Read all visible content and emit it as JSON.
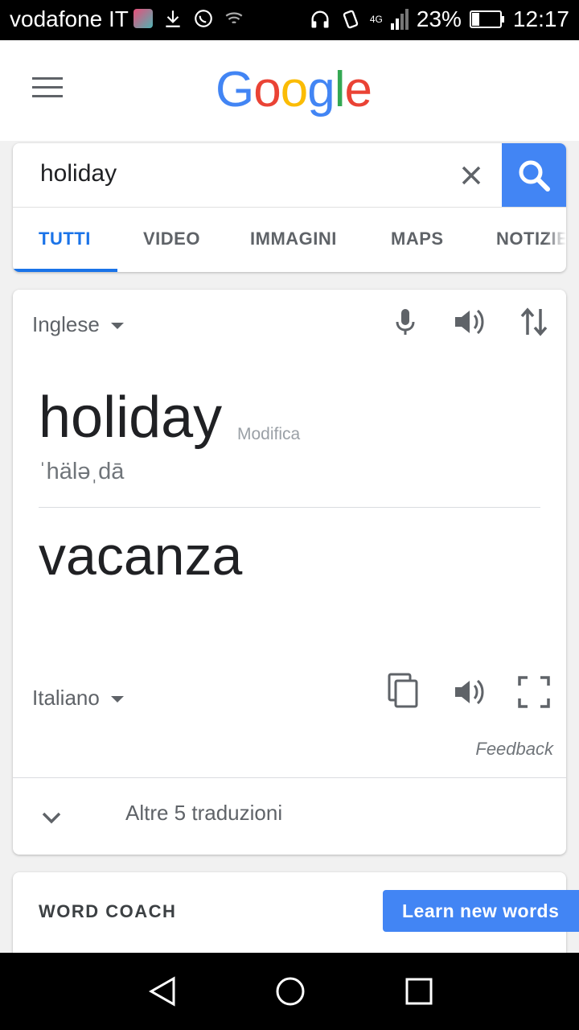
{
  "status_bar": {
    "carrier": "vodafone IT",
    "network": "4G",
    "battery": "23%",
    "time": "12:17"
  },
  "header": {
    "logo": {
      "letters": [
        "G",
        "o",
        "o",
        "g",
        "l",
        "e"
      ],
      "colors": [
        "#4285f4",
        "#ea4335",
        "#fbbc05",
        "#4285f4",
        "#34a853",
        "#ea4335"
      ]
    }
  },
  "search": {
    "query": "holiday",
    "tabs": [
      "TUTTI",
      "VIDEO",
      "IMMAGINI",
      "MAPS",
      "NOTIZIE"
    ],
    "active_tab": "TUTTI",
    "accent": "#4285f4"
  },
  "translate": {
    "source_lang": "Inglese",
    "source_word": "holiday",
    "edit_label": "Modifica",
    "phonetic": "ˈhäləˌdā",
    "target_word": "vacanza",
    "target_lang": "Italiano",
    "feedback": "Feedback",
    "more_translations": "Altre 5 traduzioni"
  },
  "word_coach": {
    "title": "WORD COACH",
    "button": "Learn new words"
  }
}
